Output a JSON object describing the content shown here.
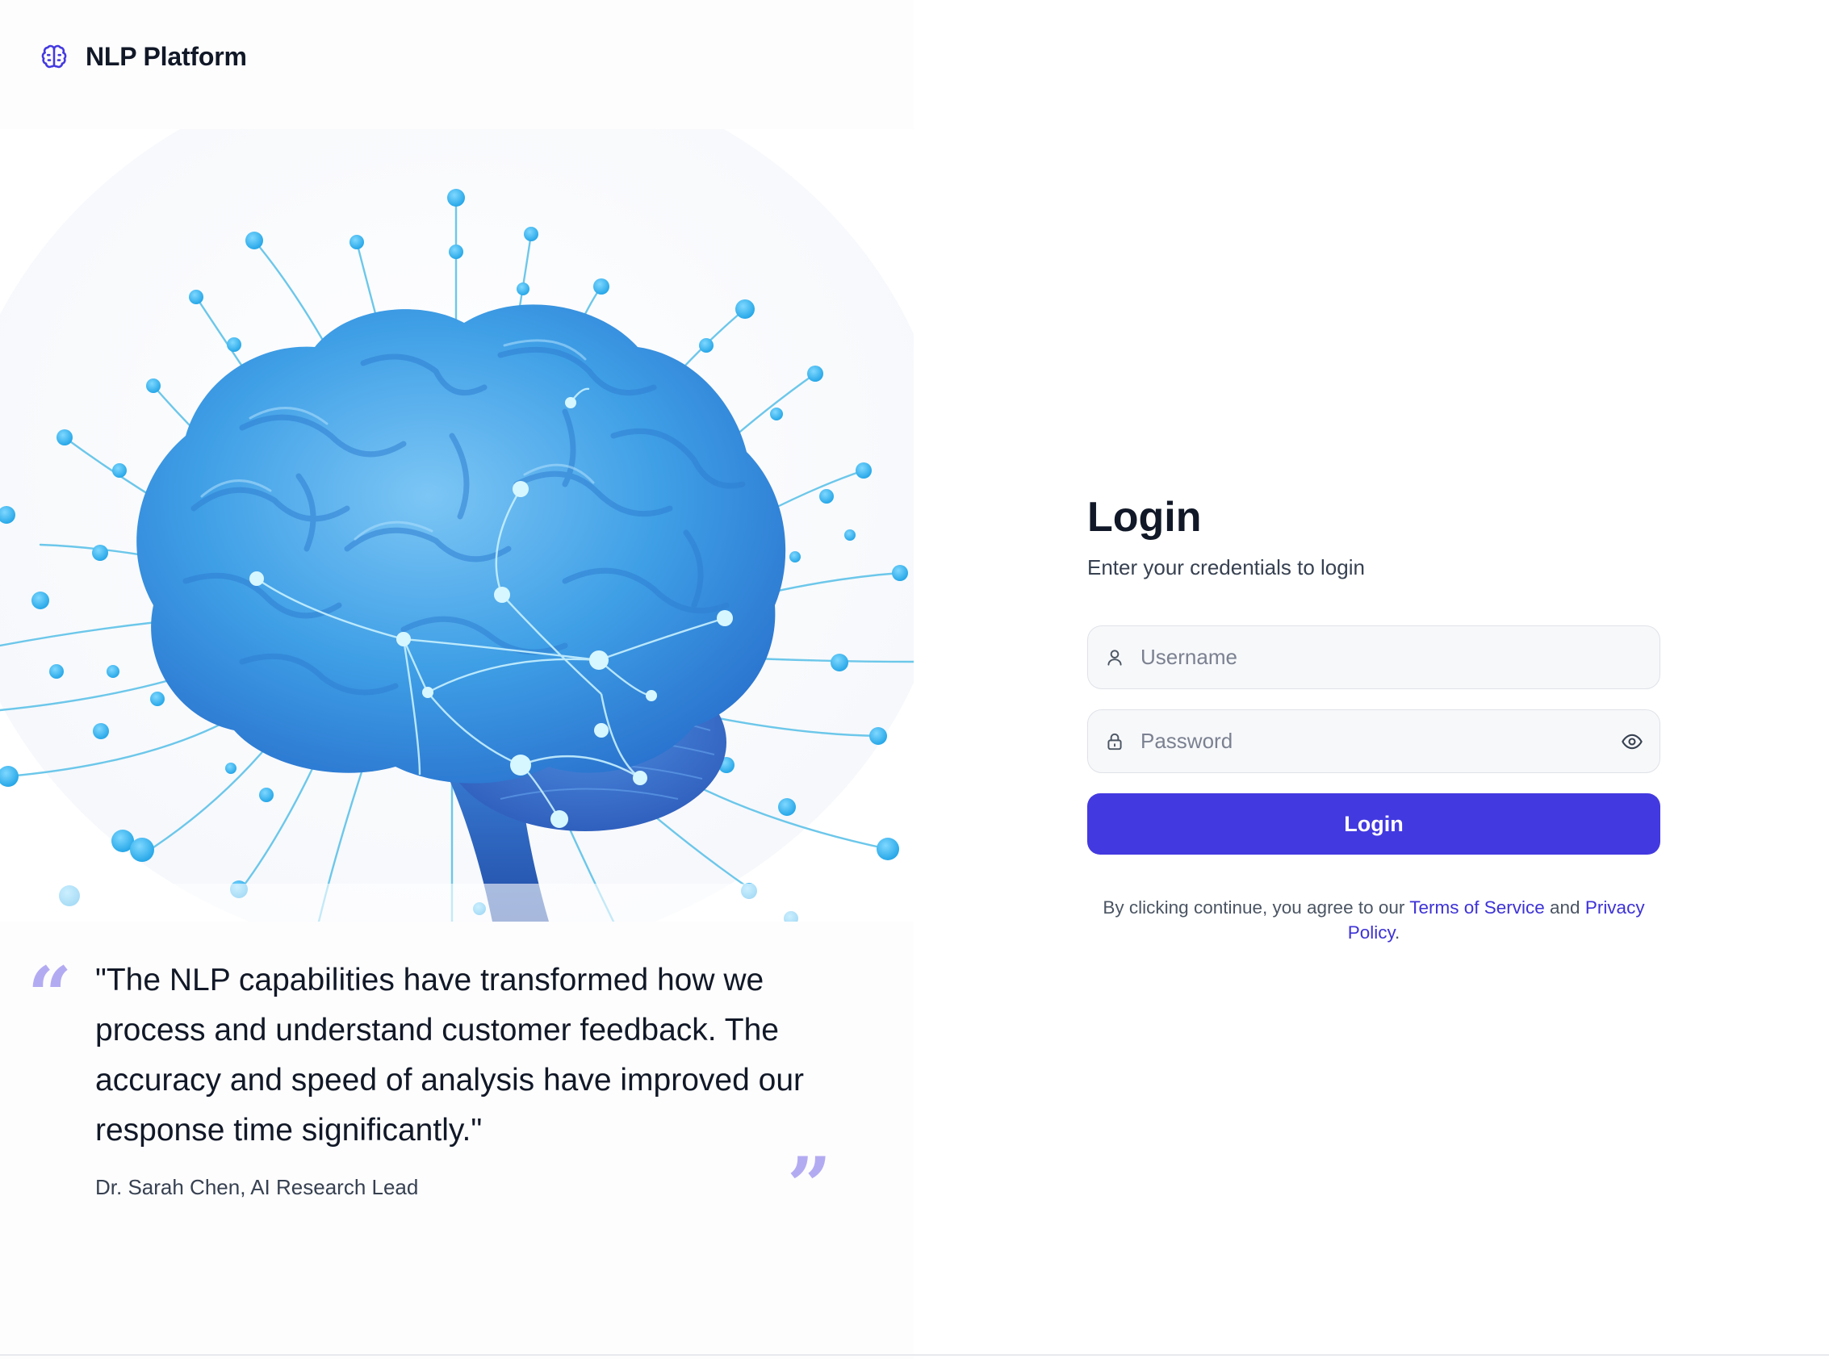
{
  "brand": {
    "name": "NLP Platform",
    "icon": "brain-icon",
    "color": "#4339e0"
  },
  "hero": {
    "image": "brain-network-illustration"
  },
  "testimonial": {
    "quote": "\"The NLP capabilities have transformed how we process and understand customer feedback. The accuracy and speed of analysis have improved our response time significantly.\"",
    "author": "Dr. Sarah Chen, AI Research Lead",
    "open_quote_mark": "“",
    "close_quote_mark": "”",
    "quote_mark_color": "#b3abf2"
  },
  "login": {
    "title": "Login",
    "subtitle": "Enter your credentials to login",
    "username_placeholder": "Username",
    "username_icon": "user-icon",
    "password_placeholder": "Password",
    "password_icon": "lock-icon",
    "password_toggle_icon": "eye-icon",
    "submit_label": "Login",
    "accent_color": "#4339e0"
  },
  "terms": {
    "prefix": "By clicking continue, you agree to our ",
    "terms_link": "Terms of Service",
    "middle": " and ",
    "privacy_link": "Privacy Policy",
    "suffix": "."
  }
}
